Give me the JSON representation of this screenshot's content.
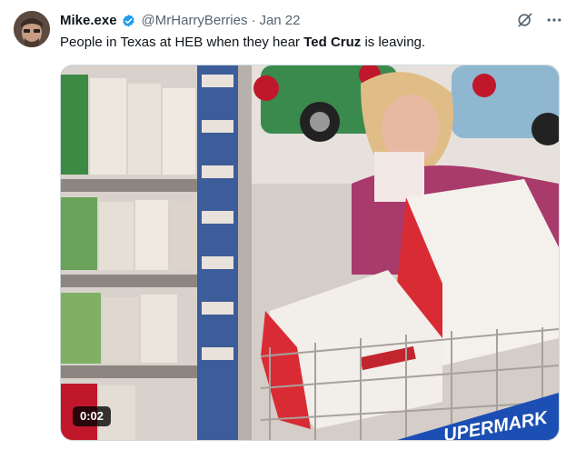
{
  "tweet": {
    "author_name": "Mike.exe",
    "author_handle": "@MrHarryBerries",
    "separator": "·",
    "date": "Jan 22",
    "text_before": "People in Texas at HEB when they hear ",
    "text_bold": "Ted Cruz",
    "text_after": " is leaving."
  },
  "video": {
    "timestamp": "0:02",
    "overlay_text": "UPERMARK"
  },
  "icons": {
    "verified": "verified-badge-icon",
    "grok": "grok-icon",
    "more": "more-options-icon"
  },
  "colors": {
    "verified": "#1d9bf0",
    "text": "#0f1419",
    "muted": "#536471"
  }
}
